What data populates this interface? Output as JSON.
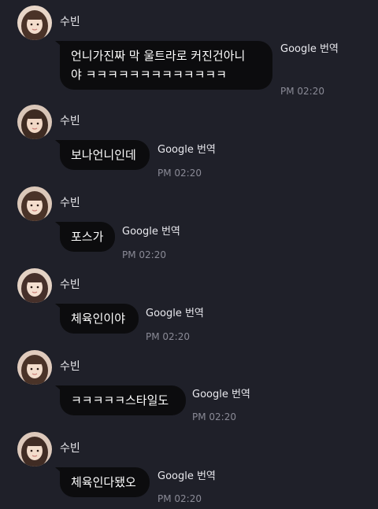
{
  "messages": [
    {
      "sender": "수빈",
      "text": "언니가진짜 막 울트라로 커진건아니\n야 ㅋㅋㅋㅋㅋㅋㅋㅋㅋㅋㅋㅋㅋ",
      "translate_label": "Google 번역",
      "time": "PM 02:20"
    },
    {
      "sender": "수빈",
      "text": "보나언니인데",
      "translate_label": "Google 번역",
      "time": "PM 02:20"
    },
    {
      "sender": "수빈",
      "text": "포스가",
      "translate_label": "Google 번역",
      "time": "PM 02:20"
    },
    {
      "sender": "수빈",
      "text": "체육인이야",
      "translate_label": "Google 번역",
      "time": "PM 02:20"
    },
    {
      "sender": "수빈",
      "text": "ㅋㅋㅋㅋㅋ스타일도",
      "translate_label": "Google 번역",
      "time": "PM 02:20"
    },
    {
      "sender": "수빈",
      "text": "체육인다됐오",
      "translate_label": "Google 번역",
      "time": "PM 02:20"
    }
  ],
  "colors": {
    "background": "#1f2029",
    "bubble": "#0c0c0e",
    "time": "#8a8a96"
  }
}
